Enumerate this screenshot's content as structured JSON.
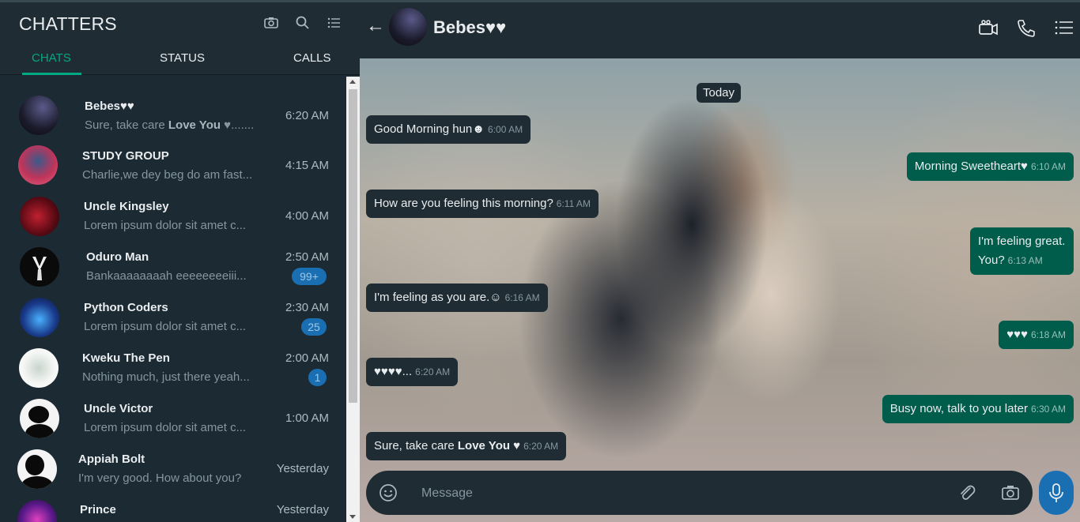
{
  "app": {
    "title": "CHATTERS"
  },
  "left_header": {
    "icons": [
      "camera-icon",
      "search-icon",
      "menu-icon"
    ],
    "tabs": [
      {
        "label": "CHATS",
        "active": true
      },
      {
        "label": "STATUS",
        "active": false
      },
      {
        "label": "CALLS",
        "active": false
      }
    ]
  },
  "chats": [
    {
      "name": "Bebes♥♥",
      "preview": "Sure, take care ",
      "preview_bold": "Love You",
      "preview_tail": " ♥.......",
      "time": "6:20 AM",
      "badge": ""
    },
    {
      "name": "STUDY GROUP",
      "preview": "Charlie,we dey beg do am fast...",
      "time": "4:15 AM",
      "badge": ""
    },
    {
      "name": "Uncle Kingsley",
      "preview": "Lorem ipsum dolor sit amet c...",
      "time": "4:00 AM",
      "badge": ""
    },
    {
      "name": "Oduro Man",
      "preview": "Bankaaaaaaaah eeeeeeeeiii...",
      "time": "2:50 AM",
      "badge": "99+"
    },
    {
      "name": "Python Coders",
      "preview": "Lorem ipsum dolor sit amet c...",
      "time": "2:30 AM",
      "badge": "25"
    },
    {
      "name": "Kweku The Pen",
      "preview": "Nothing much, just there yeah...",
      "time": "2:00 AM",
      "badge": "1"
    },
    {
      "name": "Uncle Victor",
      "preview": "Lorem ipsum dolor sit amet c...",
      "time": "1:00 AM",
      "badge": ""
    },
    {
      "name": "Appiah Bolt",
      "preview": "I'm very good. How about you?",
      "time": "Yesterday",
      "badge": ""
    },
    {
      "name": "Prince",
      "preview": "",
      "time": "Yesterday",
      "badge": ""
    }
  ],
  "conversation": {
    "contact_name": "Bebes♥♥",
    "header_icons": [
      "video-call-icon",
      "phone-icon",
      "menu-icon"
    ],
    "day_label": "Today",
    "messages": [
      {
        "direction": "in",
        "text": "Good Morning hun☻",
        "time": "6:00 AM"
      },
      {
        "direction": "out",
        "text": "Morning Sweetheart♥",
        "time": "6:10 AM"
      },
      {
        "direction": "in",
        "text": "How are you feeling this morning?",
        "time": "6:11 AM"
      },
      {
        "direction": "out",
        "text": "I'm feeling great.",
        "text2": "You?",
        "time": "6:13 AM"
      },
      {
        "direction": "in",
        "text": "I'm feeling as you are.☺",
        "time": "6:16 AM"
      },
      {
        "direction": "out",
        "text": "♥♥♥",
        "time": "6:18 AM"
      },
      {
        "direction": "in",
        "text": "♥♥♥♥...",
        "time": "6:20 AM"
      },
      {
        "direction": "out",
        "text": "Busy now, talk to you later",
        "time": "6:30 AM"
      },
      {
        "direction": "in",
        "text": "Sure, take care ",
        "text_bold": "Love You",
        "text_tail": " ♥",
        "time": "6:20 AM"
      }
    ]
  },
  "composer": {
    "placeholder": "Message",
    "icons": [
      "emoji-icon",
      "attach-icon",
      "camera-icon",
      "mic-icon"
    ]
  },
  "colors": {
    "header_bg": "#1f2c33",
    "accent_green": "#00a884",
    "outgoing_bubble": "#005c4b",
    "incoming_bubble": "#1f2c33",
    "badge_blue": "#1a6fb3"
  }
}
